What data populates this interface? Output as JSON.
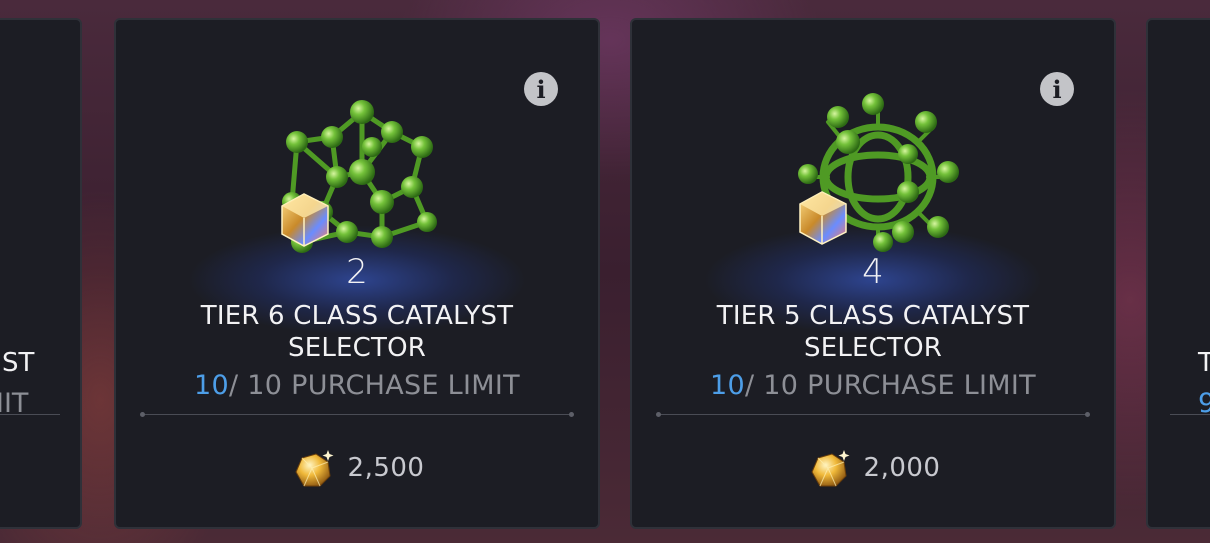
{
  "cards": [
    {
      "quantity": "2",
      "name_line1": "TIER 6 CLASS CATALYST",
      "name_line2": "SELECTOR",
      "limit_current": "10",
      "limit_rest": "/ 10 PURCHASE LIMIT",
      "price": "2,500",
      "icon": "info-icon",
      "currency_icon": "gold-crystal-icon"
    },
    {
      "quantity": "4",
      "name_line1": "TIER 5 CLASS CATALYST",
      "name_line2": "SELECTOR",
      "limit_current": "10",
      "limit_rest": "/ 10 PURCHASE LIMIT",
      "price": "2,000",
      "icon": "info-icon",
      "currency_icon": "gold-crystal-icon"
    }
  ],
  "left_partial": {
    "name_fragment": "ST",
    "limit_fragment": "IIT"
  },
  "right_partial": {
    "name_fragment": "T",
    "limit_fragment": "9"
  },
  "colors": {
    "card_bg": "#1c1d24",
    "accent_blue": "#4d9ee8",
    "catalyst_green": "#5fae2e",
    "muted_text": "#8d8f96"
  }
}
